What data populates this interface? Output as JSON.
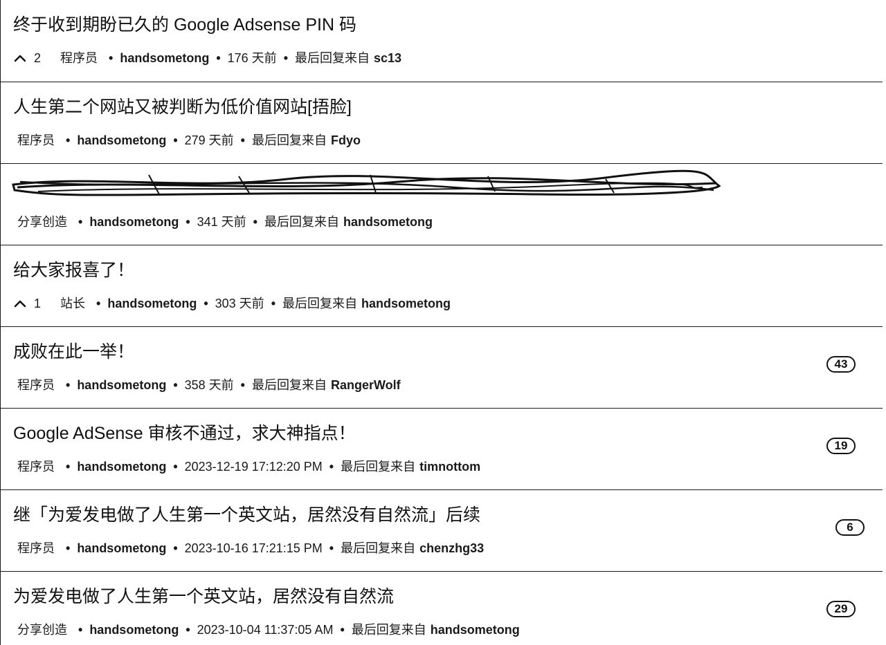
{
  "topics": [
    {
      "title": "终于收到期盼已久的 Google Adsense PIN 码",
      "votes": "2",
      "node": "程序员",
      "author": "handsometong",
      "time": "176 天前",
      "last_reply_label": "最后回复来自",
      "last_reply_user": "sc13",
      "reply_count": ""
    },
    {
      "title": "人生第二个网站又被判断为低价值网站[捂脸]",
      "votes": "",
      "node": "程序员",
      "author": "handsometong",
      "time": "279 天前",
      "last_reply_label": "最后回复来自",
      "last_reply_user": "Fdyo",
      "reply_count": ""
    },
    {
      "title": "",
      "votes": "",
      "node": "分享创造",
      "author": "handsometong",
      "time": "341 天前",
      "last_reply_label": "最后回复来自",
      "last_reply_user": "handsometong",
      "reply_count": "",
      "redacted": true
    },
    {
      "title": "给大家报喜了！",
      "votes": "1",
      "node": "站长",
      "author": "handsometong",
      "time": "303 天前",
      "last_reply_label": "最后回复来自",
      "last_reply_user": "handsometong",
      "reply_count": ""
    },
    {
      "title": "成败在此一举！",
      "votes": "",
      "node": "程序员",
      "author": "handsometong",
      "time": "358 天前",
      "last_reply_label": "最后回复来自",
      "last_reply_user": "RangerWolf",
      "reply_count": "43"
    },
    {
      "title": "Google AdSense 审核不通过，求大神指点！",
      "votes": "",
      "node": "程序员",
      "author": "handsometong",
      "time": "2023-12-19 17:12:20 PM",
      "last_reply_label": "最后回复来自",
      "last_reply_user": "timnottom",
      "reply_count": "19"
    },
    {
      "title": "继「为爱发电做了人生第一个英文站，居然没有自然流」后续",
      "votes": "",
      "node": "程序员",
      "author": "handsometong",
      "time": "2023-10-16 17:21:15 PM",
      "last_reply_label": "最后回复来自",
      "last_reply_user": "chenzhg33",
      "reply_count": "6"
    },
    {
      "title": "为爱发电做了人生第一个英文站，居然没有自然流",
      "votes": "",
      "node": "分享创造",
      "author": "handsometong",
      "time": "2023-10-04 11:37:05 AM",
      "last_reply_label": "最后回复来自",
      "last_reply_user": "handsometong",
      "reply_count": "29"
    }
  ],
  "separator": "•"
}
